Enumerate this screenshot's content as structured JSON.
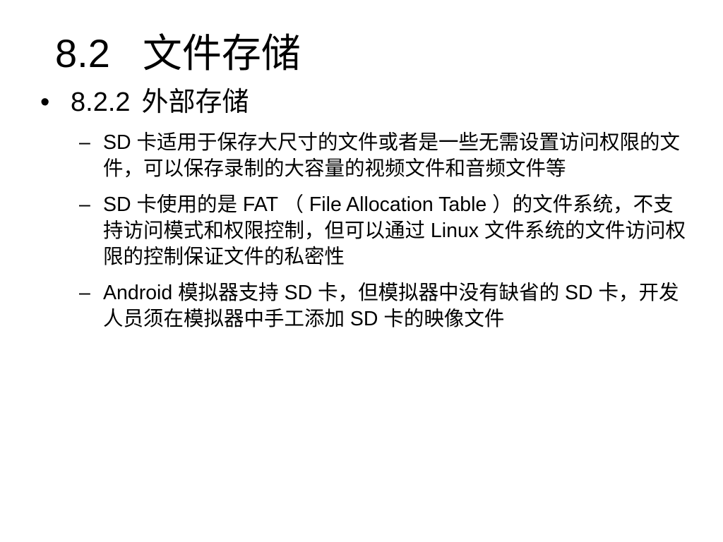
{
  "slide": {
    "title_number": "8.2",
    "title_text": "文件存储",
    "section_bullet": "•",
    "section_number": "8.2.2",
    "section_text": "外部存储",
    "sub_dash": "–",
    "items": [
      {
        "text": "SD 卡适用于保存大尺寸的文件或者是一些无需设置访问权限的文件，可以保存录制的大容量的视频文件和音频文件等"
      },
      {
        "text": "SD 卡使用的是 FAT （ File Allocation Table ）的文件系统，不支持访问模式和权限控制，但可以通过 Linux 文件系统的文件访问权限的控制保证文件的私密性"
      },
      {
        "text": "Android 模拟器支持 SD 卡，但模拟器中没有缺省的 SD 卡，开发人员须在模拟器中手工添加 SD 卡的映像文件"
      }
    ]
  }
}
